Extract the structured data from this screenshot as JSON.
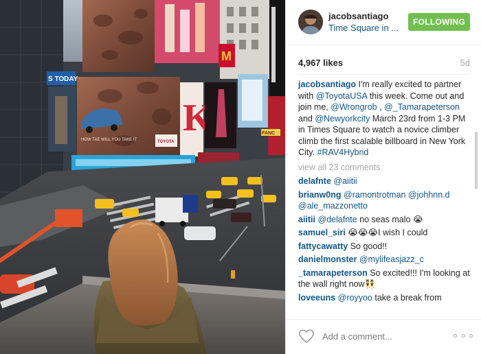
{
  "header": {
    "username": "jacobsantiago",
    "location": "Time Square in ...",
    "follow_label": "FOLLOWING"
  },
  "meta": {
    "likes": "4,967 likes",
    "time": "5d"
  },
  "caption": {
    "username": "jacobsantiago",
    "t1": " I'm really excited to partner with ",
    "m1": "@ToyotaUSA",
    "t2": " this week. Come out and join me, ",
    "m2": "@Wrongrob",
    "t3": " , ",
    "m3": "@_Tamarapeterson",
    "t4": " and ",
    "m4": "@Newyorkcity",
    "t5": " March 23rd from 1-3 PM in Times Square to watch a novice climber climb the first scalable billboard in New York City. ",
    "hashtag": "#RAV4Hybrid"
  },
  "view_all": "view all 23 comments",
  "comments": [
    {
      "user": "delafnte",
      "pre": " ",
      "mention": "@aiitii",
      "text": ""
    },
    {
      "user": "brianw0ng",
      "pre": " ",
      "mention": "@ramontrotman @johhnn.d @ale_mazzonetto",
      "text": ""
    },
    {
      "user": "aiitii",
      "pre": " ",
      "mention": "@delafnte",
      "text": " no seas malo 😭"
    },
    {
      "user": "samuel_siri",
      "pre": " 😭😭😭I wish I could",
      "mention": "",
      "text": ""
    },
    {
      "user": "fattycawatty",
      "pre": " So good!!",
      "mention": "",
      "text": ""
    },
    {
      "user": "danielmonster",
      "pre": " ",
      "mention": "@mylifeasjazz_c",
      "text": ""
    },
    {
      "user": "_tamarapeterson",
      "pre": " So excited!!! I'm looking at the wall right now👯",
      "mention": "",
      "text": ""
    },
    {
      "user": "loveeuns",
      "pre": " ",
      "mention": "@royyoo",
      "text": " take a break from"
    }
  ],
  "footer": {
    "comment_placeholder": "Add a comment..."
  },
  "photo": {
    "sign_today": "S TODAY",
    "sign_mcd": "M",
    "sign_k": "K",
    "sign_fanc": "FANC",
    "billboard_caption": "HOW TAE WILL YOU TAKE IT",
    "toyota_brand": "TOYOTA"
  },
  "colors": {
    "accent": "#125688",
    "follow": "#70c050",
    "muted": "#a5a7aa"
  },
  "icons": {
    "like": "heart-outline-icon",
    "more": "more-options-icon"
  }
}
